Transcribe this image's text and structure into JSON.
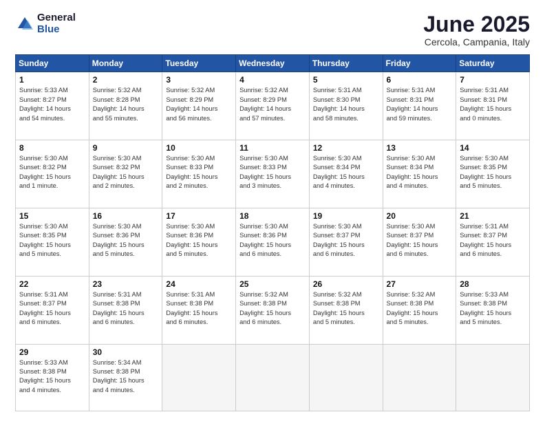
{
  "logo": {
    "general": "General",
    "blue": "Blue"
  },
  "title": "June 2025",
  "location": "Cercola, Campania, Italy",
  "days_header": [
    "Sunday",
    "Monday",
    "Tuesday",
    "Wednesday",
    "Thursday",
    "Friday",
    "Saturday"
  ],
  "weeks": [
    [
      {
        "day": "1",
        "sunrise": "5:33 AM",
        "sunset": "8:27 PM",
        "daylight": "14 hours and 54 minutes."
      },
      {
        "day": "2",
        "sunrise": "5:32 AM",
        "sunset": "8:28 PM",
        "daylight": "14 hours and 55 minutes."
      },
      {
        "day": "3",
        "sunrise": "5:32 AM",
        "sunset": "8:29 PM",
        "daylight": "14 hours and 56 minutes."
      },
      {
        "day": "4",
        "sunrise": "5:32 AM",
        "sunset": "8:29 PM",
        "daylight": "14 hours and 57 minutes."
      },
      {
        "day": "5",
        "sunrise": "5:31 AM",
        "sunset": "8:30 PM",
        "daylight": "14 hours and 58 minutes."
      },
      {
        "day": "6",
        "sunrise": "5:31 AM",
        "sunset": "8:31 PM",
        "daylight": "14 hours and 59 minutes."
      },
      {
        "day": "7",
        "sunrise": "5:31 AM",
        "sunset": "8:31 PM",
        "daylight": "15 hours and 0 minutes."
      }
    ],
    [
      {
        "day": "8",
        "sunrise": "5:30 AM",
        "sunset": "8:32 PM",
        "daylight": "15 hours and 1 minute."
      },
      {
        "day": "9",
        "sunrise": "5:30 AM",
        "sunset": "8:32 PM",
        "daylight": "15 hours and 2 minutes."
      },
      {
        "day": "10",
        "sunrise": "5:30 AM",
        "sunset": "8:33 PM",
        "daylight": "15 hours and 2 minutes."
      },
      {
        "day": "11",
        "sunrise": "5:30 AM",
        "sunset": "8:33 PM",
        "daylight": "15 hours and 3 minutes."
      },
      {
        "day": "12",
        "sunrise": "5:30 AM",
        "sunset": "8:34 PM",
        "daylight": "15 hours and 4 minutes."
      },
      {
        "day": "13",
        "sunrise": "5:30 AM",
        "sunset": "8:34 PM",
        "daylight": "15 hours and 4 minutes."
      },
      {
        "day": "14",
        "sunrise": "5:30 AM",
        "sunset": "8:35 PM",
        "daylight": "15 hours and 5 minutes."
      }
    ],
    [
      {
        "day": "15",
        "sunrise": "5:30 AM",
        "sunset": "8:35 PM",
        "daylight": "15 hours and 5 minutes."
      },
      {
        "day": "16",
        "sunrise": "5:30 AM",
        "sunset": "8:36 PM",
        "daylight": "15 hours and 5 minutes."
      },
      {
        "day": "17",
        "sunrise": "5:30 AM",
        "sunset": "8:36 PM",
        "daylight": "15 hours and 5 minutes."
      },
      {
        "day": "18",
        "sunrise": "5:30 AM",
        "sunset": "8:36 PM",
        "daylight": "15 hours and 6 minutes."
      },
      {
        "day": "19",
        "sunrise": "5:30 AM",
        "sunset": "8:37 PM",
        "daylight": "15 hours and 6 minutes."
      },
      {
        "day": "20",
        "sunrise": "5:30 AM",
        "sunset": "8:37 PM",
        "daylight": "15 hours and 6 minutes."
      },
      {
        "day": "21",
        "sunrise": "5:31 AM",
        "sunset": "8:37 PM",
        "daylight": "15 hours and 6 minutes."
      }
    ],
    [
      {
        "day": "22",
        "sunrise": "5:31 AM",
        "sunset": "8:37 PM",
        "daylight": "15 hours and 6 minutes."
      },
      {
        "day": "23",
        "sunrise": "5:31 AM",
        "sunset": "8:38 PM",
        "daylight": "15 hours and 6 minutes."
      },
      {
        "day": "24",
        "sunrise": "5:31 AM",
        "sunset": "8:38 PM",
        "daylight": "15 hours and 6 minutes."
      },
      {
        "day": "25",
        "sunrise": "5:32 AM",
        "sunset": "8:38 PM",
        "daylight": "15 hours and 6 minutes."
      },
      {
        "day": "26",
        "sunrise": "5:32 AM",
        "sunset": "8:38 PM",
        "daylight": "15 hours and 5 minutes."
      },
      {
        "day": "27",
        "sunrise": "5:32 AM",
        "sunset": "8:38 PM",
        "daylight": "15 hours and 5 minutes."
      },
      {
        "day": "28",
        "sunrise": "5:33 AM",
        "sunset": "8:38 PM",
        "daylight": "15 hours and 5 minutes."
      }
    ],
    [
      {
        "day": "29",
        "sunrise": "5:33 AM",
        "sunset": "8:38 PM",
        "daylight": "15 hours and 4 minutes."
      },
      {
        "day": "30",
        "sunrise": "5:34 AM",
        "sunset": "8:38 PM",
        "daylight": "15 hours and 4 minutes."
      },
      {
        "day": "",
        "sunrise": "",
        "sunset": "",
        "daylight": ""
      },
      {
        "day": "",
        "sunrise": "",
        "sunset": "",
        "daylight": ""
      },
      {
        "day": "",
        "sunrise": "",
        "sunset": "",
        "daylight": ""
      },
      {
        "day": "",
        "sunrise": "",
        "sunset": "",
        "daylight": ""
      },
      {
        "day": "",
        "sunrise": "",
        "sunset": "",
        "daylight": ""
      }
    ]
  ]
}
